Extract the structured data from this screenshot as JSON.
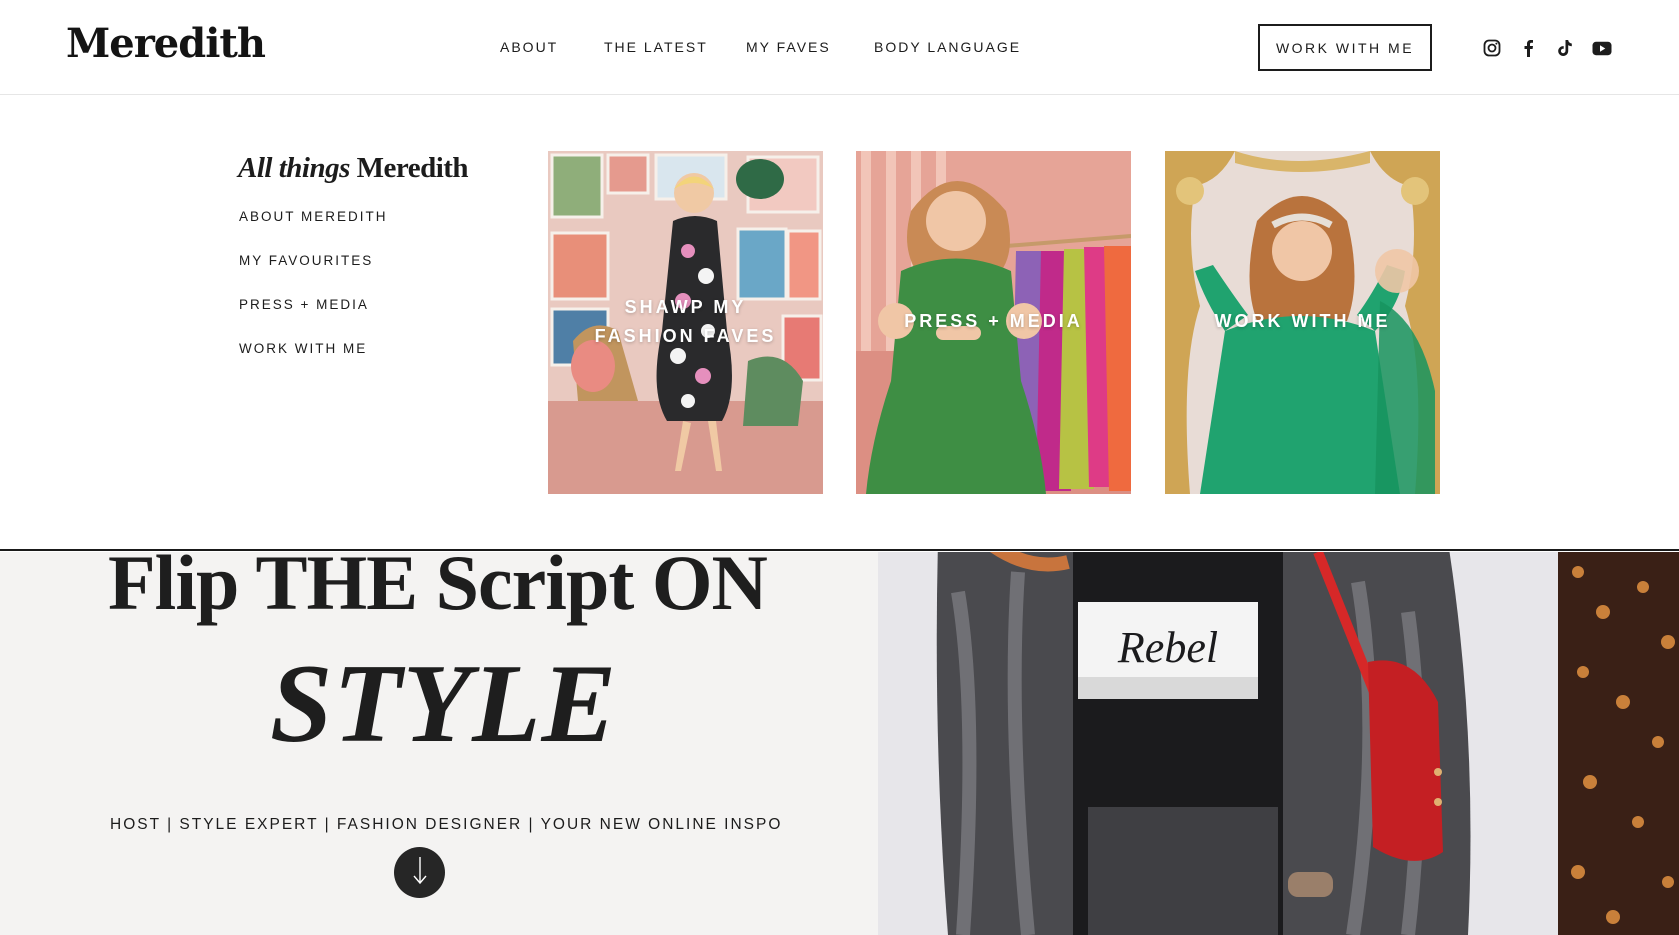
{
  "header": {
    "logo": "Meredith",
    "nav": [
      {
        "label": "ABOUT"
      },
      {
        "label": "THE LATEST"
      },
      {
        "label": "MY FAVES"
      },
      {
        "label": "BODY LANGUAGE"
      }
    ],
    "cta": "WORK WITH ME",
    "social_icons": [
      "instagram-icon",
      "facebook-icon",
      "tiktok-icon",
      "youtube-icon"
    ]
  },
  "mega_menu": {
    "title_italic": "All things",
    "title_rest": " Meredith",
    "links": [
      {
        "label": "ABOUT MEREDITH"
      },
      {
        "label": "MY FAVOURITES"
      },
      {
        "label": "PRESS + MEDIA"
      },
      {
        "label": "WORK WITH ME"
      }
    ],
    "cards": [
      {
        "line1": "SHAWP MY",
        "line2": "FASHION FAVES"
      },
      {
        "line1": "PRESS + MEDIA"
      },
      {
        "line1": "WORK WITH ME"
      }
    ]
  },
  "hero": {
    "line1": "Flip THE Script ON",
    "line2": "STYLE",
    "tagline": "HOST | STYLE EXPERT | FASHION DESIGNER | YOUR NEW ONLINE INSPO",
    "scroll_icon": "arrow-down-icon",
    "shirt_text": "Rebel"
  },
  "colors": {
    "text": "#1c1c1c",
    "hero_bg": "#f4f3f2",
    "dark_button": "#262626"
  }
}
